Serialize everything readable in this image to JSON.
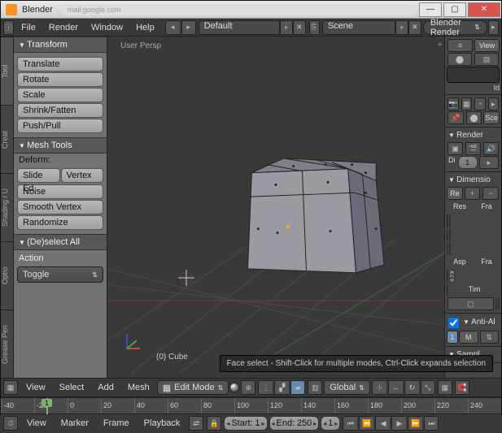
{
  "app": {
    "title": "Blender",
    "ghost_tab": "mail.google.com"
  },
  "winbtns": {
    "min": "—",
    "max": "▢",
    "close": "✕"
  },
  "menubar": {
    "items": [
      "File",
      "Render",
      "Window",
      "Help"
    ],
    "layout": "Default",
    "scene": "Scene",
    "engine": "Blender Render"
  },
  "left_vtabs": [
    "Tool",
    "Creat",
    "Shading / U",
    "Optio",
    "Grease Pen"
  ],
  "transform": {
    "title": "Transform",
    "buttons": [
      "Translate",
      "Rotate",
      "Scale",
      "Shrink/Fatten",
      "Push/Pull"
    ]
  },
  "meshtools": {
    "title": "Mesh Tools",
    "deform_label": "Deform:",
    "row": [
      "Slide Ed",
      "Vertex"
    ],
    "buttons": [
      "Noise",
      "Smooth Vertex",
      "Randomize"
    ]
  },
  "deselect": {
    "title": "(De)select All",
    "action_label": "Action",
    "action_value": "Toggle"
  },
  "viewport": {
    "persp": "User Persp",
    "object": "(0) Cube"
  },
  "vpheader": {
    "menus": [
      "View",
      "Select",
      "Add",
      "Mesh"
    ],
    "mode": "Edit Mode",
    "orientation": "Global"
  },
  "tooltip": "Face select - Shift-Click for multiple modes, Ctrl-Click expands selection",
  "right": {
    "view_btn": "View",
    "id_label": "Id",
    "sce_label": "Sce",
    "render": {
      "title": "Render",
      "di_label": "Di",
      "di_val": "1"
    },
    "dimensions": {
      "title": "Dimensio",
      "re_label": "Re",
      "res": "Res",
      "fra": "Fra",
      "asp": "Asp",
      "tim": "Tim",
      "two": "2"
    },
    "anti": {
      "title": "Anti-Al",
      "m": "M",
      "one": "1"
    },
    "sample": "Sampl"
  },
  "timeline": {
    "ticks": [
      "-40",
      "-20",
      "0",
      "20",
      "40",
      "60",
      "80",
      "100",
      "120",
      "140",
      "160",
      "180",
      "200",
      "220",
      "240"
    ],
    "current": "1",
    "menus": [
      "View",
      "Marker",
      "Frame",
      "Playback"
    ],
    "start_label": "Start:",
    "start_val": "1",
    "end_label": "End:",
    "end_val": "250",
    "cur_val": "1"
  }
}
